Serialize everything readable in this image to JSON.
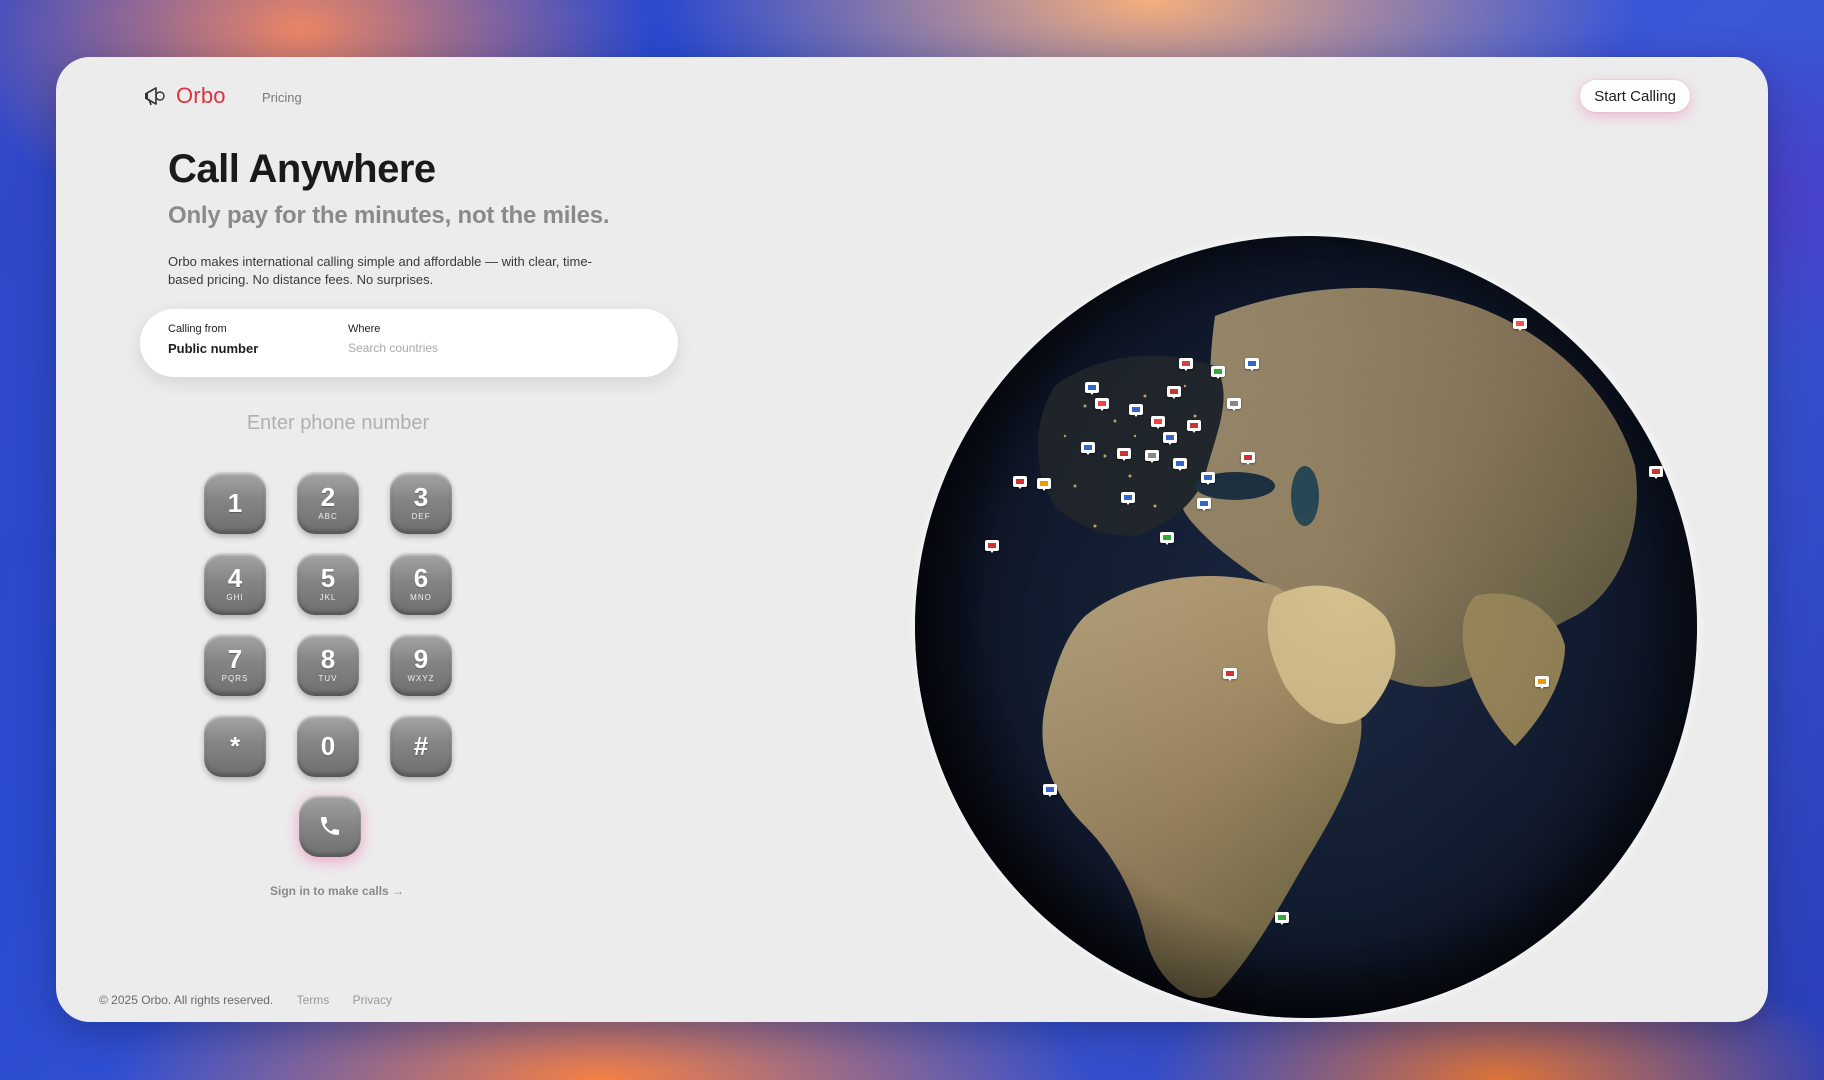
{
  "brand": {
    "name": "Orbo",
    "color": "#e0313e",
    "icon": "megaphone-icon"
  },
  "nav": {
    "pricing": "Pricing",
    "cta": "Start Calling"
  },
  "hero": {
    "title": "Call Anywhere",
    "subtitle": "Only pay for the minutes, not the miles.",
    "description": "Orbo makes international calling simple and affordable — with clear, time-based pricing. No distance fees. No surprises."
  },
  "search": {
    "from_label": "Calling from",
    "from_value": "Public number",
    "where_label": "Where",
    "where_placeholder": "Search countries"
  },
  "dialer": {
    "placeholder": "Enter phone number",
    "keys": [
      {
        "digit": "1",
        "letters": ""
      },
      {
        "digit": "2",
        "letters": "ABC"
      },
      {
        "digit": "3",
        "letters": "DEF"
      },
      {
        "digit": "4",
        "letters": "GHI"
      },
      {
        "digit": "5",
        "letters": "JKL"
      },
      {
        "digit": "6",
        "letters": "MNO"
      },
      {
        "digit": "7",
        "letters": "PQRS"
      },
      {
        "digit": "8",
        "letters": "TUV"
      },
      {
        "digit": "9",
        "letters": "WXYZ"
      },
      {
        "digit": "*",
        "letters": ""
      },
      {
        "digit": "0",
        "letters": ""
      },
      {
        "digit": "#",
        "letters": ""
      }
    ],
    "call_icon": "phone-icon",
    "signin": "Sign in to make calls →"
  },
  "footer": {
    "copyright": "© 2025 Orbo. All rights reserved.",
    "terms": "Terms",
    "privacy": "Privacy"
  },
  "globe": {
    "icon": "earth-globe-icon"
  }
}
